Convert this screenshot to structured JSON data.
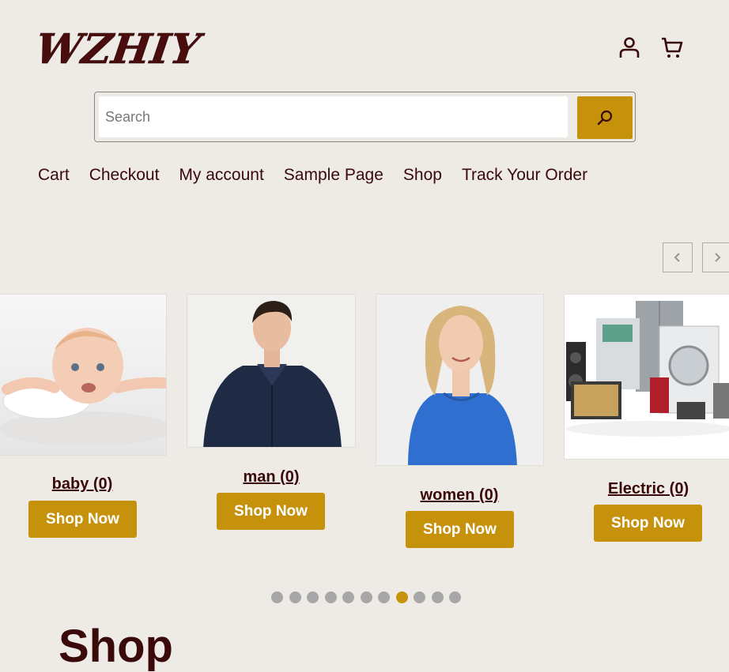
{
  "header": {
    "logo_text": "WZHIY",
    "account_icon": "user-icon",
    "cart_icon": "cart-icon"
  },
  "search": {
    "placeholder": "Search",
    "value": "",
    "button_icon": "search-icon"
  },
  "nav": {
    "items": [
      "Cart",
      "Checkout",
      "My account",
      "Sample Page",
      "Shop",
      "Track Your Order"
    ]
  },
  "carousel": {
    "prev_icon": "chevron-left-icon",
    "next_icon": "chevron-right-icon",
    "categories": [
      {
        "label": "baby (0)",
        "button": "Shop Now",
        "image": "baby photo"
      },
      {
        "label": "man (0)",
        "button": "Shop Now",
        "image": "man in navy shirt photo"
      },
      {
        "label": "women (0)",
        "button": "Shop Now",
        "image": "woman in blue top photo"
      },
      {
        "label": "Electric (0)",
        "button": "Shop Now",
        "image": "home appliances photo"
      }
    ],
    "dots_total": 11,
    "active_dot": 8
  },
  "main": {
    "heading": "Shop"
  },
  "colors": {
    "background": "#EEEAE6",
    "accent": "#C6920C",
    "text": "#3A0A0A",
    "dot_inactive": "#A7A7A7"
  }
}
